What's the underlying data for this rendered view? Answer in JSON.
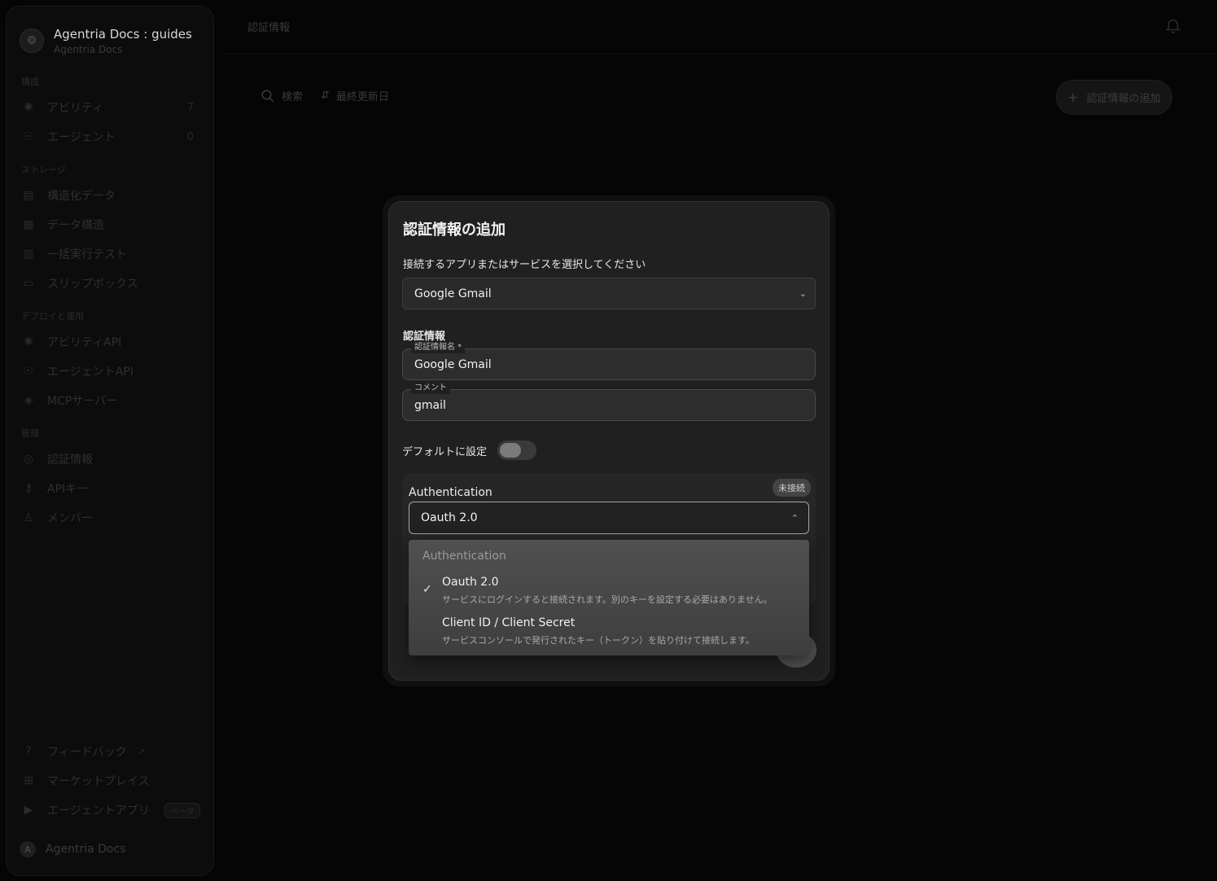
{
  "sidebar": {
    "workspace_title": "Agentria Docs : guides",
    "workspace_subtitle": "Agentria Docs",
    "sections": {
      "build": "構成",
      "storage": "ストレージ",
      "deploy": "デプロイと運用",
      "manage": "管理"
    },
    "items": [
      {
        "label": "アビリティ",
        "icon": "ability-icon",
        "count": "7"
      },
      {
        "label": "エージェント",
        "icon": "agent-icon",
        "count": "0"
      },
      {
        "label": "構造化データ",
        "icon": "database-icon"
      },
      {
        "label": "データ構造",
        "icon": "schema-icon"
      },
      {
        "label": "一括実行テスト",
        "icon": "batch-test-icon"
      },
      {
        "label": "スリップボックス",
        "icon": "slipbox-icon"
      },
      {
        "label": "アビリティAPI",
        "icon": "ability-api-icon"
      },
      {
        "label": "エージェントAPI",
        "icon": "agent-api-icon"
      },
      {
        "label": "MCPサーバー",
        "icon": "mcp-icon"
      },
      {
        "label": "認証情報",
        "icon": "credential-icon"
      },
      {
        "label": "APIキー",
        "icon": "key-icon"
      },
      {
        "label": "メンバー",
        "icon": "user-icon"
      }
    ],
    "bottom_items": [
      {
        "label": "フィードバック",
        "icon": "help-icon"
      },
      {
        "label": "マーケットプレイス",
        "icon": "store-icon"
      },
      {
        "label": "エージェントアプリ",
        "icon": "play-icon",
        "badge": "ベータ"
      }
    ],
    "account": {
      "initial": "A",
      "name": "Agentria Docs"
    }
  },
  "header": {
    "breadcrumb": "認証情報"
  },
  "toolbar": {
    "search_label": "検索",
    "sort_label": "最終更新日",
    "add_button": "認証情報の追加"
  },
  "modal": {
    "title": "認証情報の追加",
    "service_prompt": "接続するアプリまたはサービスを選択してください",
    "service_value": "Google Gmail",
    "credentials_section": "認証情報",
    "name_label": "認証情報名 *",
    "name_value": "Google Gmail",
    "comment_label": "コメント",
    "comment_value": "gmail",
    "default_label": "デフォルトに設定",
    "default_on": false,
    "auth_title": "Authentication",
    "status_badge": "未接続",
    "auth_value": "Oauth 2.0"
  },
  "dropdown": {
    "header": "Authentication",
    "options": [
      {
        "title": "Oauth 2.0",
        "desc": "サービスにログインすると接続されます。別のキーを設定する必要はありません。",
        "selected": true
      },
      {
        "title": "Client ID / Client Secret",
        "desc": "サービスコンソールで発行されたキー（トークン）を貼り付けて接続します。",
        "selected": false
      }
    ]
  }
}
